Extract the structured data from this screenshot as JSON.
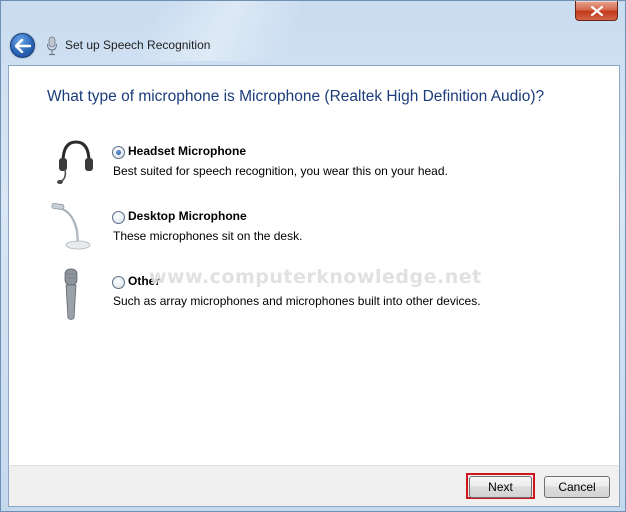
{
  "window": {
    "title": "Set up Speech Recognition",
    "close_symbol": "✕"
  },
  "main": {
    "heading": "What type of microphone is Microphone (Realtek High Definition Audio)?",
    "options": [
      {
        "label": "Headset Microphone",
        "description": "Best suited for speech recognition, you wear this on your head.",
        "selected": true,
        "icon": "headset-microphone-icon"
      },
      {
        "label": "Desktop Microphone",
        "description": "These microphones sit on the desk.",
        "selected": false,
        "icon": "desktop-microphone-icon"
      },
      {
        "label": "Other",
        "description": "Such as array microphones and microphones built into other devices.",
        "selected": false,
        "icon": "handheld-microphone-icon"
      }
    ],
    "watermark": "www.computerknowledge.net"
  },
  "footer": {
    "next_label": "Next",
    "cancel_label": "Cancel"
  },
  "colors": {
    "heading": "#1b3c7a",
    "highlight": "#d0141e",
    "close_button": "#c2391a"
  }
}
